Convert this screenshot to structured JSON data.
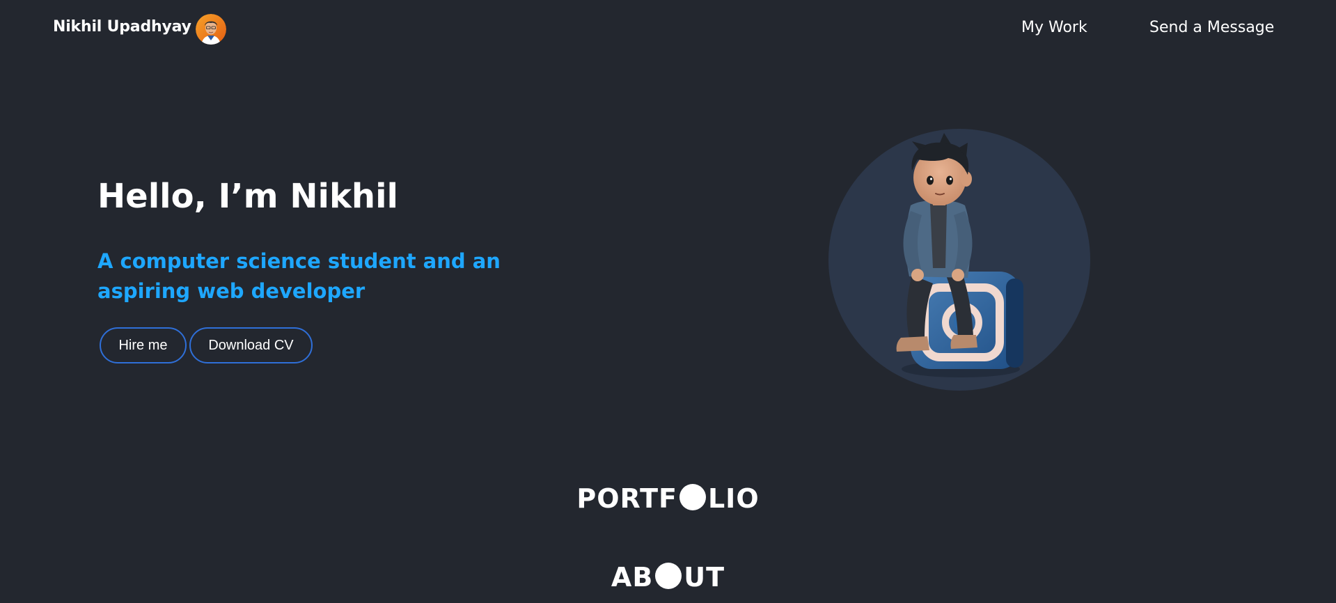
{
  "navbar": {
    "brand": "Nikhil Upadhyay",
    "links": [
      "My Work",
      "Send a Message"
    ]
  },
  "hero": {
    "title": "Hello, I’m Nikhil",
    "subtitle": "A computer science student and an aspiring web developer",
    "buttons": [
      "Hire me",
      "Download CV"
    ]
  },
  "sections": {
    "portfolio_pre": "PORTF",
    "portfolio_post": "LIO",
    "about_pre": "AB",
    "about_post": "UT"
  },
  "colors": {
    "background": "#23272f",
    "accent": "#1ea7ff",
    "button_border": "#2f6fd8",
    "figure_bg": "#2c374a"
  }
}
